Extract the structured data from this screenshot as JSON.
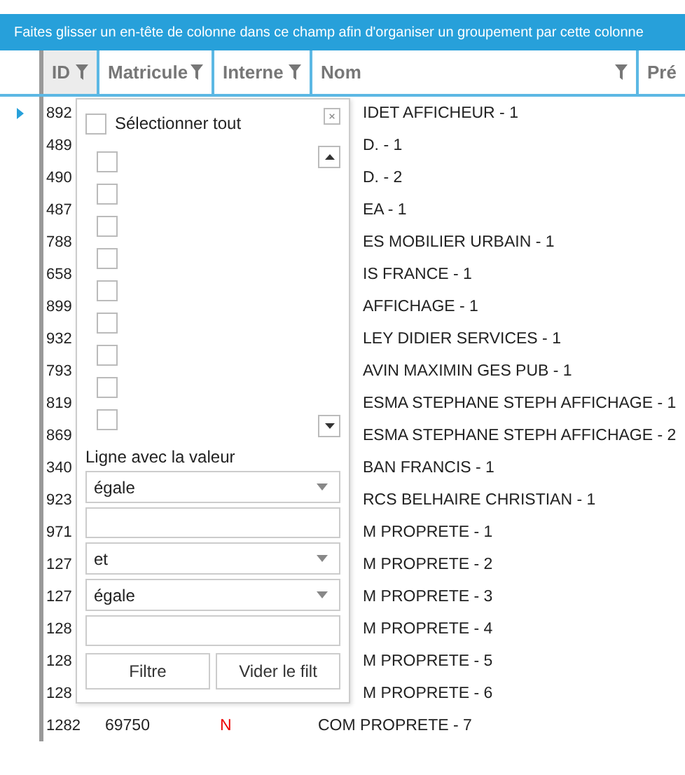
{
  "group_panel": {
    "text": "Faites glisser un en-tête de colonne dans ce champ afin d'organiser un groupement par cette colonne"
  },
  "columns": [
    {
      "label": "ID",
      "filter_open": true
    },
    {
      "label": "Matricule",
      "filter_open": false
    },
    {
      "label": "Interne",
      "filter_open": false
    },
    {
      "label": "Nom",
      "filter_open": false
    },
    {
      "label": "Pré",
      "filter_open": false
    }
  ],
  "rows": [
    {
      "current": true,
      "id": "892",
      "nom": "IDET AFFICHEUR - 1"
    },
    {
      "current": false,
      "id": "489",
      "nom": "D. - 1"
    },
    {
      "current": false,
      "id": "490",
      "nom": "D. - 2"
    },
    {
      "current": false,
      "id": "487",
      "nom": "EA - 1"
    },
    {
      "current": false,
      "id": "788",
      "nom": "ES MOBILIER URBAIN - 1"
    },
    {
      "current": false,
      "id": "658",
      "nom": "IS FRANCE - 1"
    },
    {
      "current": false,
      "id": "899",
      "nom": "AFFICHAGE - 1"
    },
    {
      "current": false,
      "id": "932",
      "nom": "LEY DIDIER SERVICES - 1"
    },
    {
      "current": false,
      "id": "793",
      "nom": "AVIN MAXIMIN GES PUB - 1"
    },
    {
      "current": false,
      "id": "819",
      "nom": "ESMA STEPHANE STEPH AFFICHAGE - 1"
    },
    {
      "current": false,
      "id": "869",
      "nom": "ESMA STEPHANE STEPH AFFICHAGE - 2"
    },
    {
      "current": false,
      "id": "340",
      "nom": "BAN FRANCIS - 1"
    },
    {
      "current": false,
      "id": "923",
      "nom": "RCS BELHAIRE CHRISTIAN - 1"
    },
    {
      "current": false,
      "id": "971",
      "nom": "M PROPRETE - 1"
    },
    {
      "current": false,
      "id": "127",
      "nom": "M PROPRETE - 2"
    },
    {
      "current": false,
      "id": "127",
      "nom": "M PROPRETE - 3"
    },
    {
      "current": false,
      "id": "128",
      "nom": "M PROPRETE - 4"
    },
    {
      "current": false,
      "id": "128",
      "nom": "M PROPRETE - 5"
    },
    {
      "current": false,
      "id": "128",
      "nom": "M PROPRETE - 6"
    },
    {
      "current": false,
      "id": "1282",
      "matricule": "69750",
      "interne": "N",
      "nom": "COM PROPRETE - 7"
    }
  ],
  "filter_popup": {
    "select_all": {
      "label": "Sélectionner tout",
      "checked": false
    },
    "values": [
      {
        "checked": false
      },
      {
        "checked": false
      },
      {
        "checked": false
      },
      {
        "checked": false
      },
      {
        "checked": false
      },
      {
        "checked": false
      },
      {
        "checked": false
      },
      {
        "checked": false
      },
      {
        "checked": false
      }
    ],
    "condition_label": "Ligne avec la valeur",
    "operator_1": "égale",
    "logic": "et",
    "operator_2": "égale",
    "buttons": [
      "Filtre",
      "Vider le filt"
    ]
  }
}
